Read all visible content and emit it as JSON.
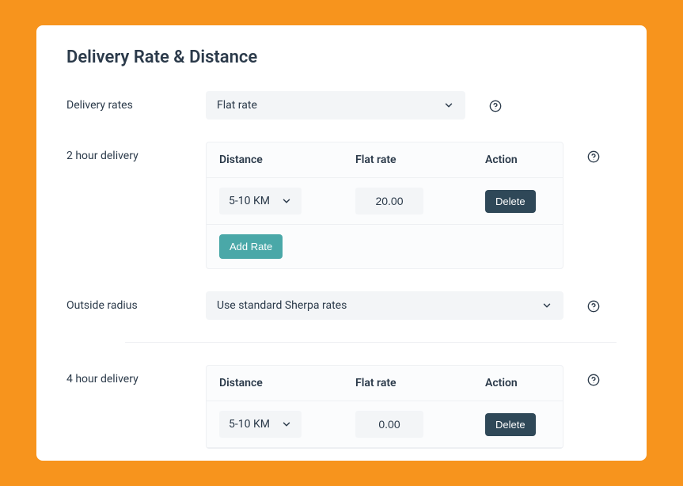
{
  "title": "Delivery Rate & Distance",
  "rows": {
    "delivery_rates": {
      "label": "Delivery rates",
      "select": "Flat rate"
    },
    "two_hour": {
      "label": "2 hour delivery",
      "headers": {
        "distance": "Distance",
        "rate": "Flat rate",
        "action": "Action"
      },
      "row": {
        "distance": "5-10 KM",
        "rate": "20.00",
        "delete": "Delete"
      },
      "add": "Add Rate"
    },
    "outside_radius": {
      "label": "Outside radius",
      "select": "Use standard Sherpa rates"
    },
    "four_hour": {
      "label": "4 hour delivery",
      "headers": {
        "distance": "Distance",
        "rate": "Flat rate",
        "action": "Action"
      },
      "row": {
        "distance": "5-10 KM",
        "rate": "0.00",
        "delete": "Delete"
      }
    }
  }
}
